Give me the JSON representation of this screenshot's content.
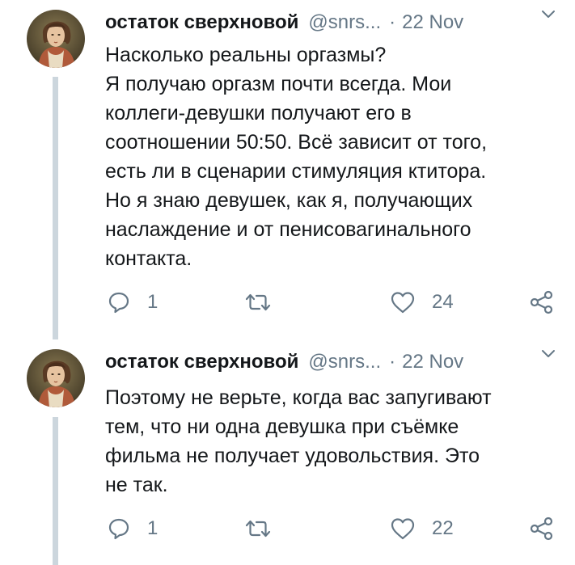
{
  "tweets": [
    {
      "author_name": "остаток сверхновой",
      "handle": "@snrs...",
      "separator": "·",
      "date": "22 Nov",
      "text": "Насколько реальны оргазмы?\nЯ получаю оргазм почти всегда. Мои\nколлеги-девушки получают его в\nсоотношении 50:50. Всё зависит от того,\nесть ли в сценарии стимуляция ктитора.\nНо я знаю девушек, как я, получающих\nнаслаждение и от пенисовагинального\nконтакта.",
      "replies": "1",
      "likes": "24"
    },
    {
      "author_name": "остаток сверхновой",
      "handle": "@snrs...",
      "separator": "·",
      "date": "22 Nov",
      "text": "Поэтому не верьте, когда вас запугивают\nтем, что ни одна девушка при съёмке\nфильма не получает удовольствия. Это\nне так.",
      "replies": "1",
      "likes": "22"
    }
  ],
  "icons": {
    "avatar": "classical-portrait-painting",
    "chevron": "chevron-down-icon",
    "reply": "reply-icon",
    "retweet": "retweet-icon",
    "like": "heart-icon",
    "share": "share-icon"
  },
  "colors": {
    "text": "#14171a",
    "secondary": "#657786",
    "thread_line": "#ccd6dd",
    "background": "#ffffff"
  }
}
